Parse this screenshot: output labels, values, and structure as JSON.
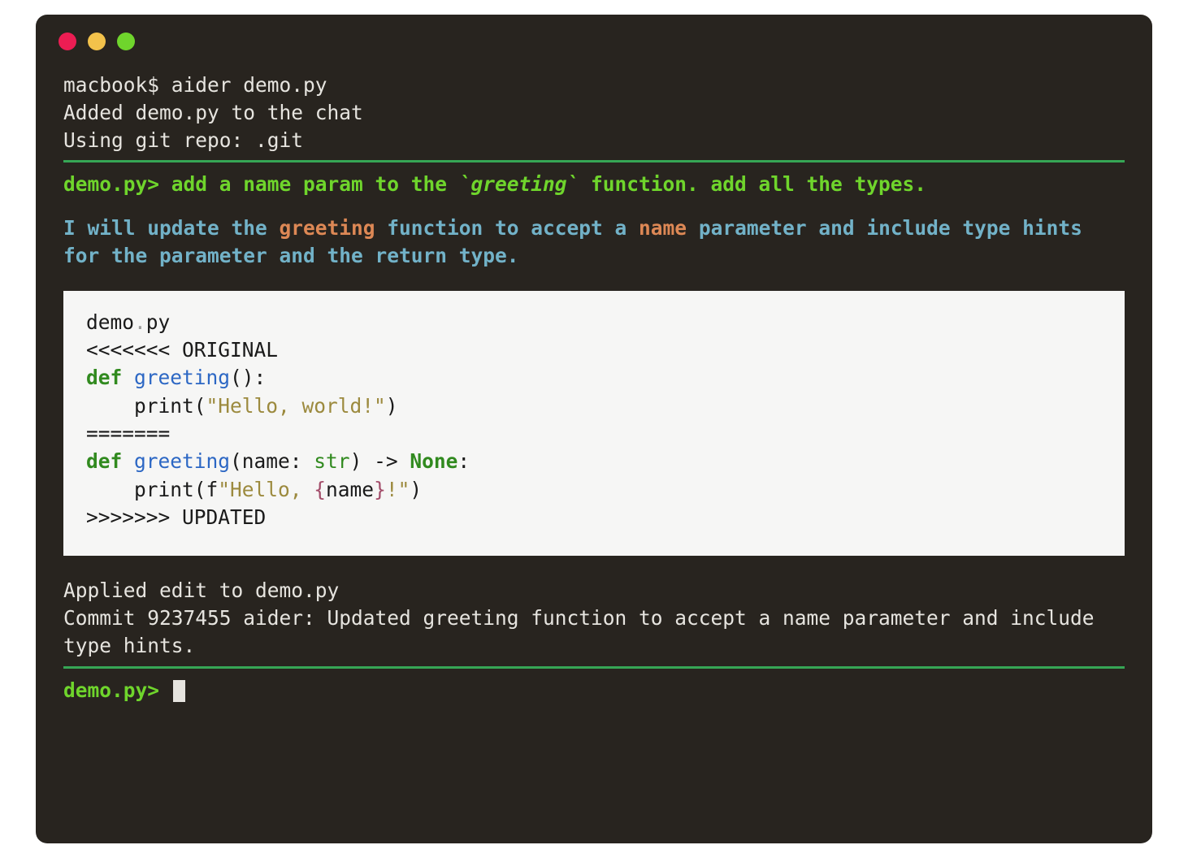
{
  "initial": {
    "line1": "macbook$ aider demo.py",
    "line2": "Added demo.py to the chat",
    "line3": "Using git repo: .git"
  },
  "prompt": {
    "label": "demo.py> ",
    "user_before": "add a name param to the ",
    "user_code": "`greeting`",
    "user_after": " function. add all the types."
  },
  "assistant": {
    "t1": "I will update the ",
    "kw1": "greeting",
    "t2": " function to accept a ",
    "kw2": "name",
    "t3": " parameter and include type hints for the parameter and the return type."
  },
  "code": {
    "file_a": "demo",
    "file_dot": ".",
    "file_b": "py",
    "m_orig": "<<<<<<< ORIGINAL",
    "def_kw": "def",
    "fn1_name": " greeting",
    "fn1_args": "():",
    "body1_a": "    print(",
    "body1_str": "\"Hello, world!\"",
    "body1_b": ")",
    "sep": "=======",
    "fn2_name": " greeting",
    "fn2_a": "(name: ",
    "fn2_type": "str",
    "fn2_b": ") ",
    "fn2_arrow": "->",
    "fn2_sp": " ",
    "fn2_none": "None",
    "fn2_c": ":",
    "body2_a": "    print(f",
    "body2_s1": "\"Hello, ",
    "body2_b1": "{",
    "body2_name": "name",
    "body2_b2": "}",
    "body2_s2": "!\"",
    "body2_b": ")",
    "m_upd": ">>>>>>> UPDATED"
  },
  "status": {
    "line1": "Applied edit to demo.py",
    "line2": "Commit 9237455 aider: Updated greeting function to accept a name parameter and include type hints."
  },
  "prompt2": {
    "label": "demo.py> "
  }
}
